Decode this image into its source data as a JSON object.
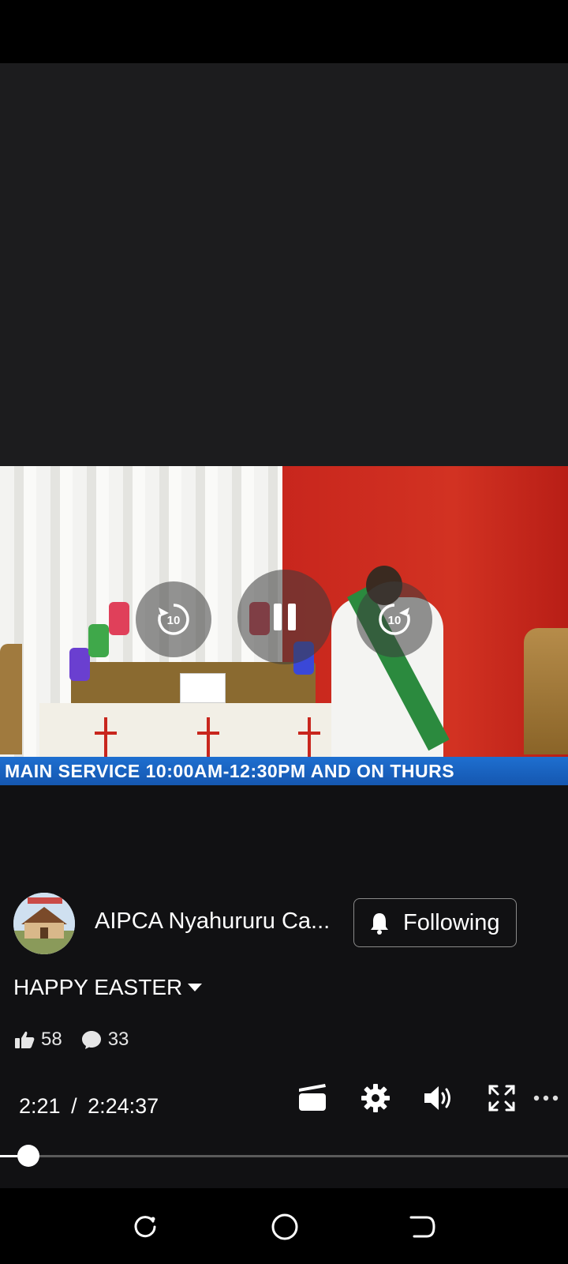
{
  "video": {
    "ticker_text": "MAIN SERVICE 10:00AM-12:30PM  AND ON THURS",
    "rewind_label": "10",
    "forward_label": "10"
  },
  "channel": {
    "name": "AIPCA Nyahururu Ca...",
    "follow_label": "Following"
  },
  "post": {
    "title": "HAPPY EASTER",
    "likes": "58",
    "comments": "33"
  },
  "player": {
    "current_time": "2:21",
    "separator": "/",
    "duration": "2:24:37",
    "progress_fraction": 0.016
  },
  "icons": [
    "rewind-10-icon",
    "pause-icon",
    "forward-10-icon",
    "bell-icon",
    "caret-down-icon",
    "like-icon",
    "comment-icon",
    "clapperboard-icon",
    "gear-icon",
    "volume-icon",
    "fullscreen-icon",
    "more-icon",
    "recents-icon",
    "home-icon",
    "back-icon"
  ]
}
